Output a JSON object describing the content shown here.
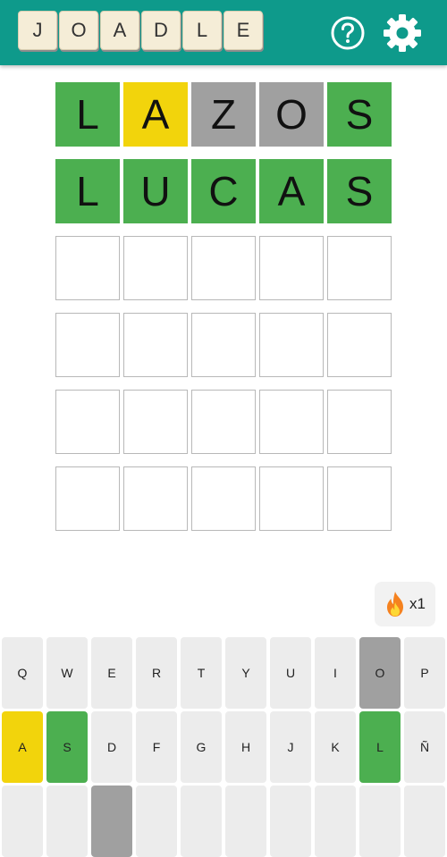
{
  "header": {
    "logo_letters": [
      "J",
      "O",
      "A",
      "D",
      "L",
      "E"
    ],
    "help_icon": "question-circle-icon",
    "settings_icon": "gear-icon"
  },
  "colors": {
    "header_bg": "#0e9a8b",
    "correct": "#4caf50",
    "present": "#f2d40c",
    "absent": "#a0a0a0",
    "key_default": "#ececec",
    "empty_border": "#b8b8b8"
  },
  "board": {
    "rows": [
      {
        "letters": [
          "L",
          "A",
          "Z",
          "O",
          "S"
        ],
        "states": [
          "correct",
          "present",
          "absent",
          "absent",
          "correct"
        ]
      },
      {
        "letters": [
          "L",
          "U",
          "C",
          "A",
          "S"
        ],
        "states": [
          "correct",
          "correct",
          "correct",
          "correct",
          "correct"
        ]
      },
      {
        "letters": [
          "",
          "",
          "",
          "",
          ""
        ],
        "states": [
          "empty",
          "empty",
          "empty",
          "empty",
          "empty"
        ]
      },
      {
        "letters": [
          "",
          "",
          "",
          "",
          ""
        ],
        "states": [
          "empty",
          "empty",
          "empty",
          "empty",
          "empty"
        ]
      },
      {
        "letters": [
          "",
          "",
          "",
          "",
          ""
        ],
        "states": [
          "empty",
          "empty",
          "empty",
          "empty",
          "empty"
        ]
      },
      {
        "letters": [
          "",
          "",
          "",
          "",
          ""
        ],
        "states": [
          "empty",
          "empty",
          "empty",
          "empty",
          "empty"
        ]
      }
    ]
  },
  "streak": {
    "icon": "fire-icon",
    "label": "x1"
  },
  "keyboard": {
    "rows": [
      [
        {
          "label": "Q",
          "state": "default"
        },
        {
          "label": "W",
          "state": "default"
        },
        {
          "label": "E",
          "state": "default"
        },
        {
          "label": "R",
          "state": "default"
        },
        {
          "label": "T",
          "state": "default"
        },
        {
          "label": "Y",
          "state": "default"
        },
        {
          "label": "U",
          "state": "default"
        },
        {
          "label": "I",
          "state": "default"
        },
        {
          "label": "O",
          "state": "absent"
        },
        {
          "label": "P",
          "state": "default"
        }
      ],
      [
        {
          "label": "A",
          "state": "present"
        },
        {
          "label": "S",
          "state": "correct"
        },
        {
          "label": "D",
          "state": "default"
        },
        {
          "label": "F",
          "state": "default"
        },
        {
          "label": "G",
          "state": "default"
        },
        {
          "label": "H",
          "state": "default"
        },
        {
          "label": "J",
          "state": "default"
        },
        {
          "label": "K",
          "state": "default"
        },
        {
          "label": "L",
          "state": "correct"
        },
        {
          "label": "Ñ",
          "state": "default"
        }
      ],
      [
        {
          "label": "",
          "state": "default"
        },
        {
          "label": "",
          "state": "default"
        },
        {
          "label": "",
          "state": "absent"
        },
        {
          "label": "",
          "state": "default"
        },
        {
          "label": "",
          "state": "default"
        },
        {
          "label": "",
          "state": "default"
        },
        {
          "label": "",
          "state": "default"
        },
        {
          "label": "",
          "state": "default"
        },
        {
          "label": "",
          "state": "default"
        },
        {
          "label": "",
          "state": "default"
        }
      ]
    ]
  }
}
